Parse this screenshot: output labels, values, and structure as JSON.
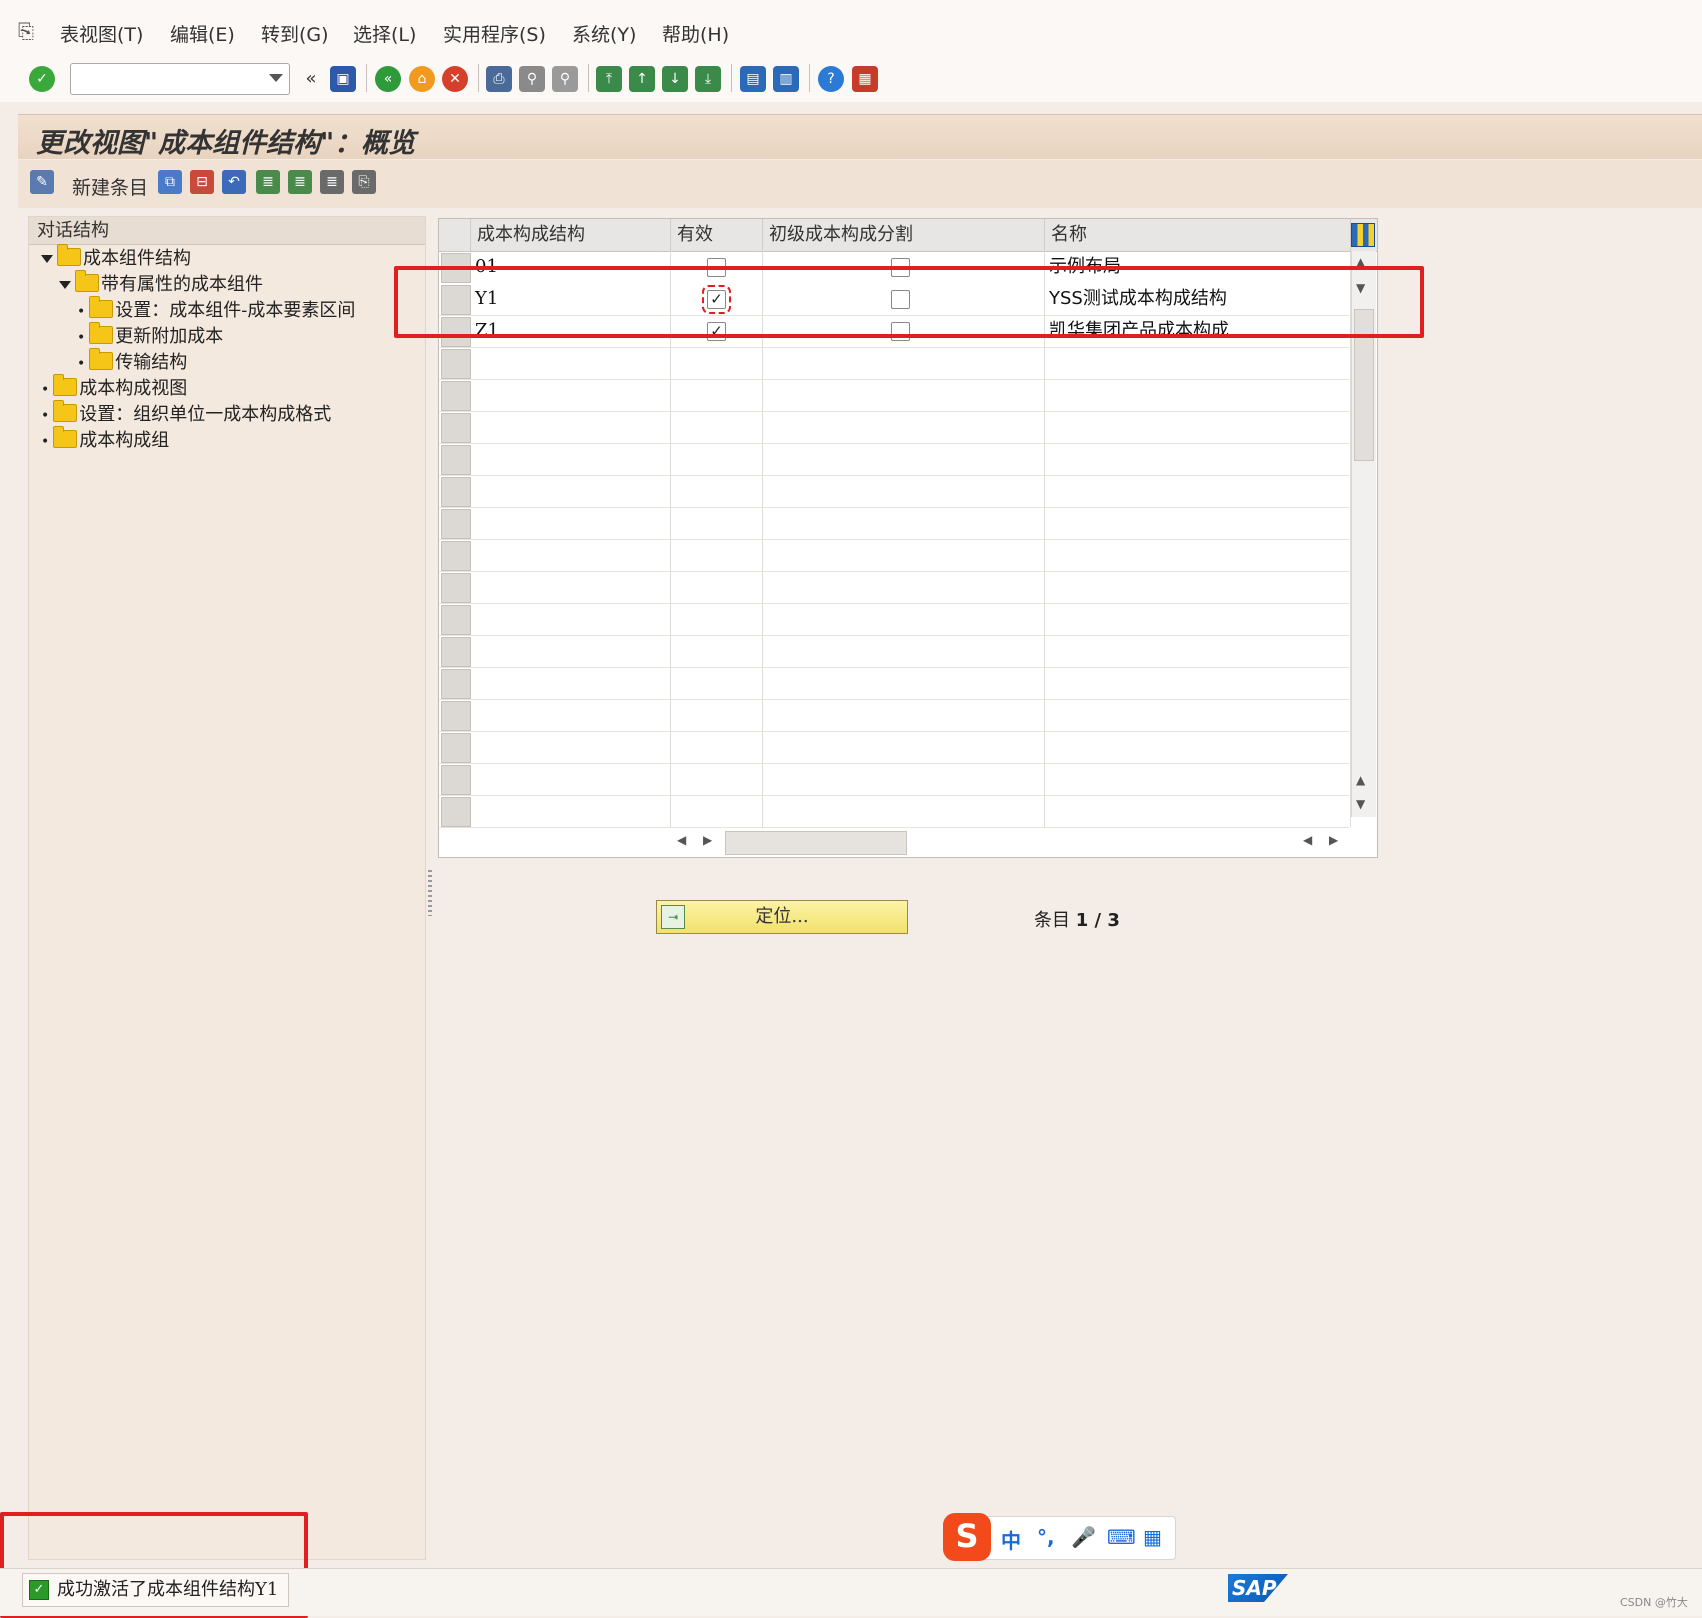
{
  "menu": {
    "items": [
      "表视图(T)",
      "编辑(E)",
      "转到(G)",
      "选择(L)",
      "实用程序(S)",
      "系统(Y)",
      "帮助(H)"
    ]
  },
  "toolbar": {
    "command_value": "",
    "icons": [
      "enter-icon",
      "back-icon",
      "exit-icon",
      "cancel-icon",
      "print-icon",
      "find-icon",
      "find-next-icon",
      "first-page-icon",
      "previous-page-icon",
      "next-page-icon",
      "last-page-icon",
      "create-session-icon",
      "shortcut-icon",
      "help-icon",
      "layout-icon"
    ],
    "save_icon": "save-icon"
  },
  "title": "更改视图\"成本组件结构\"：概览",
  "app_toolbar": {
    "new_entries_label": "新建条目"
  },
  "dialog_structure": {
    "header": "对话结构",
    "nodes": [
      {
        "label": "成本组件结构",
        "level": 0,
        "expanded": true
      },
      {
        "label": "带有属性的成本组件",
        "level": 1,
        "expanded": true
      },
      {
        "label": "设置：成本组件-成本要素区间",
        "level": 2
      },
      {
        "label": "更新附加成本",
        "level": 2
      },
      {
        "label": "传输结构",
        "level": 2
      },
      {
        "label": "成本构成视图",
        "level": 0
      },
      {
        "label": "设置：组织单位一成本构成格式",
        "level": 0
      },
      {
        "label": "成本构成组",
        "level": 0
      }
    ]
  },
  "table": {
    "columns": [
      "成本构成结构",
      "有效",
      "初级成本构成分割",
      "名称"
    ],
    "rows": [
      {
        "code": "01",
        "active": false,
        "primary": false,
        "name": "示例布局"
      },
      {
        "code": "Y1",
        "active": true,
        "primary": false,
        "name": "YSS测试成本构成结构"
      },
      {
        "code": "Z1",
        "active": true,
        "primary": false,
        "name": "凯华集团产品成本构成"
      }
    ]
  },
  "position_button_label": "定位...",
  "entry_label": "条目",
  "entry_value": "1 / 3",
  "status_message": "成功激活了成本组件结构Y1",
  "ime": {
    "items": [
      "中",
      "°,",
      "🎤",
      "⌨",
      "▦"
    ]
  },
  "sap_logo": "SAP",
  "watermark": "CSDN @竹大",
  "colors": {
    "highlight": "#e02020",
    "accent": "#1b7ad6",
    "background": "#f4ece6"
  }
}
